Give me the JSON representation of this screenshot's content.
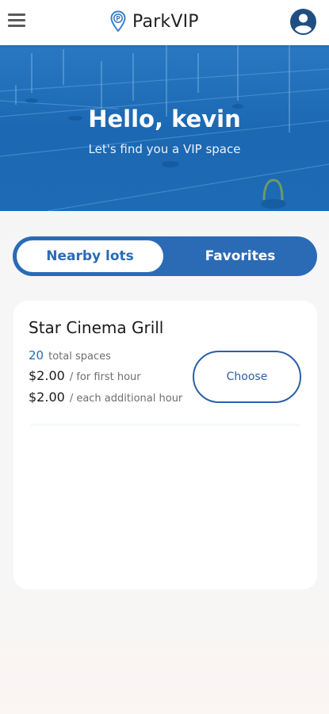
{
  "app": {
    "brand": "ParkVIP"
  },
  "icons": {
    "menu": "hamburger-menu-icon",
    "pin": "parking-pin-icon",
    "account": "account-circle-icon"
  },
  "hero": {
    "greeting": "Hello, kevin",
    "subtitle": "Let's find you a VIP space"
  },
  "tabs": [
    {
      "label": "Nearby lots",
      "active": true
    },
    {
      "label": "Favorites",
      "active": false
    }
  ],
  "lots": [
    {
      "name": "Star Cinema Grill",
      "spaces": "20",
      "spaces_label": "total spaces",
      "first_hour_price": "$2.00",
      "first_hour_label": "/ for first hour",
      "additional_price": "$2.00",
      "additional_label": "/ each additional hour",
      "action_label": "Choose"
    }
  ],
  "colors": {
    "primary": "#2b6bb6",
    "hero_blue": "#1f6cb5",
    "text": "#1a1a1a"
  }
}
